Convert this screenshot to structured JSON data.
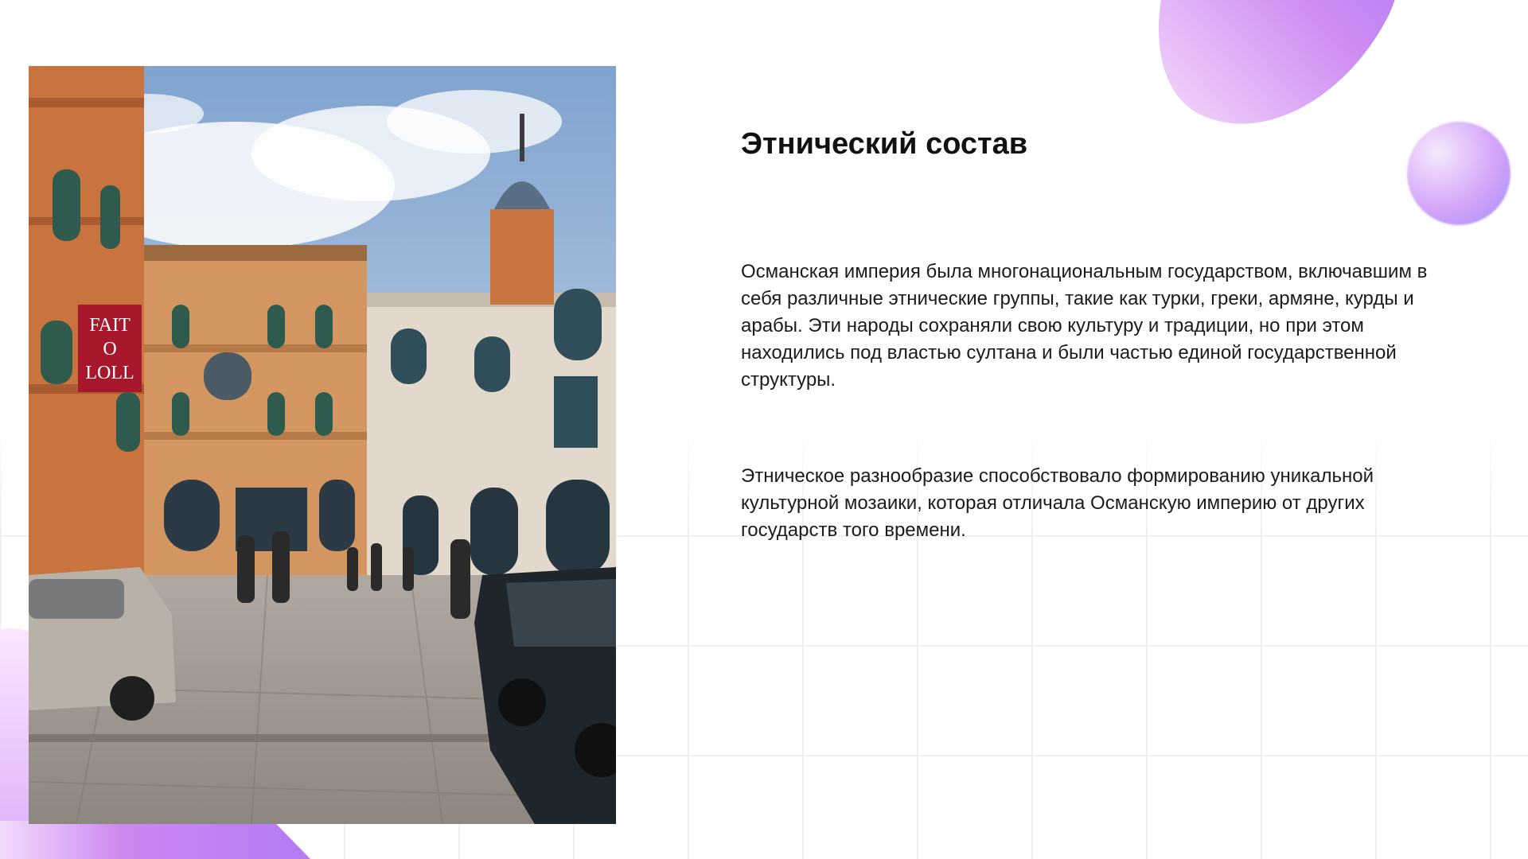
{
  "slide": {
    "title": "Этнический состав",
    "paragraphs": [
      "Османская империя была многонациональным государством, включавшим в себя различные этнические группы, такие как турки, греки, армяне, курды и арабы. Эти народы сохраняли свою культуру и традиции, но при этом находились под властью султана и были частью единой государственной структуры.",
      "Этническое разнообразие способствовало формированию уникальной культурной мозаики, которая отличала Османскую империю от других государств того времени."
    ],
    "photo": {
      "sign_text": [
        "FAIT",
        "O",
        "LOLL"
      ]
    }
  },
  "colors": {
    "accent_purple": "#a78bfa",
    "accent_pink": "#d98cf2",
    "text": "#111111"
  }
}
